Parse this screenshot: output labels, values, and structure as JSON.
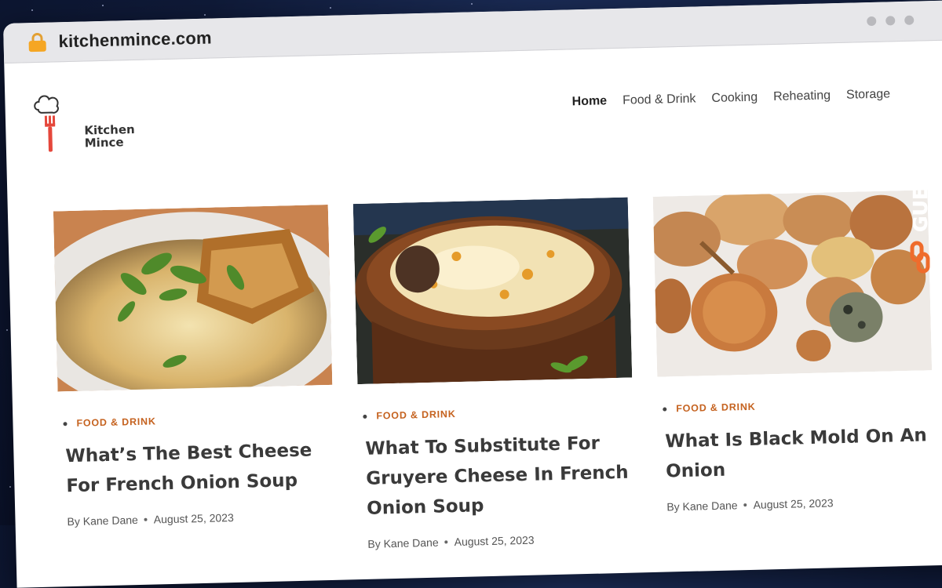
{
  "browser": {
    "url": "kitchenmince.com"
  },
  "site": {
    "logo_text_line1": "Kitchen",
    "logo_text_line2": "Mince"
  },
  "nav": {
    "items": [
      {
        "label": "Home"
      },
      {
        "label": "Food & Drink"
      },
      {
        "label": "Cooking"
      },
      {
        "label": "Reheating"
      },
      {
        "label": "Storage"
      }
    ]
  },
  "posts": [
    {
      "category": "FOOD & DRINK",
      "title": "What’s The Best Cheese For French Onion Soup",
      "author": "By Kane Dane",
      "date": "August 25, 2023"
    },
    {
      "category": "FOOD & DRINK",
      "title": "What To Substitute For Gruyere Cheese In French Onion Soup",
      "author": "By Kane Dane",
      "date": "August 25, 2023"
    },
    {
      "category": "FOOD & DRINK",
      "title": "What Is Black Mold On An Onion",
      "author": "By Kane Dane",
      "date": "August 25, 2023"
    }
  ],
  "watermark": {
    "text": "GUESTPOSTLINKS"
  },
  "colors": {
    "accent": "#c5621f",
    "watermark": "#ef6c2c"
  }
}
